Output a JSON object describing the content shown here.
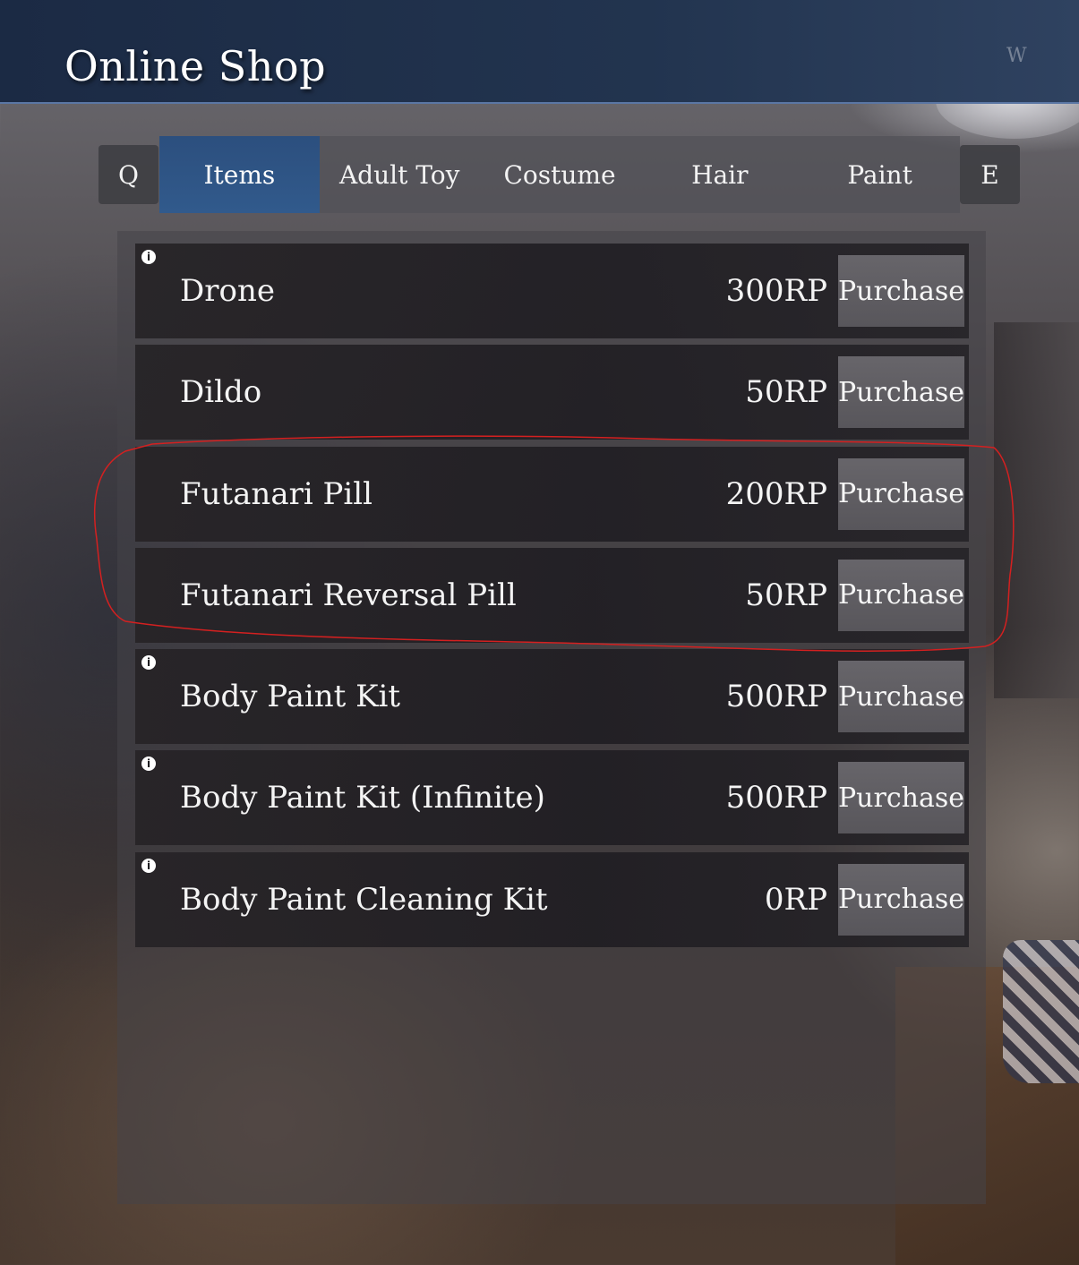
{
  "header": {
    "title": "Online Shop",
    "watermark": "W"
  },
  "nav": {
    "prev_key": "Q",
    "next_key": "E",
    "tabs": [
      {
        "label": "Items",
        "active": true
      },
      {
        "label": "Adult Toy",
        "active": false
      },
      {
        "label": "Costume",
        "active": false
      },
      {
        "label": "Hair",
        "active": false
      },
      {
        "label": "Paint",
        "active": false
      }
    ]
  },
  "items": [
    {
      "name": "Drone",
      "price": "300RP",
      "button": "Purchase",
      "has_info": true
    },
    {
      "name": "Dildo",
      "price": "50RP",
      "button": "Purchase",
      "has_info": false
    },
    {
      "name": "Futanari Pill",
      "price": "200RP",
      "button": "Purchase",
      "has_info": false
    },
    {
      "name": "Futanari Reversal Pill",
      "price": "50RP",
      "button": "Purchase",
      "has_info": false
    },
    {
      "name": "Body Paint Kit",
      "price": "500RP",
      "button": "Purchase",
      "has_info": true
    },
    {
      "name": "Body Paint Kit (Infinite)",
      "price": "500RP",
      "button": "Purchase",
      "has_info": true
    },
    {
      "name": "Body Paint Cleaning Kit",
      "price": "0RP",
      "button": "Purchase",
      "has_info": true
    }
  ],
  "info_icon_glyph": "i",
  "colors": {
    "header_bg": "#1b2a44",
    "active_tab": "#2f5587",
    "annotation": "#d42020"
  }
}
